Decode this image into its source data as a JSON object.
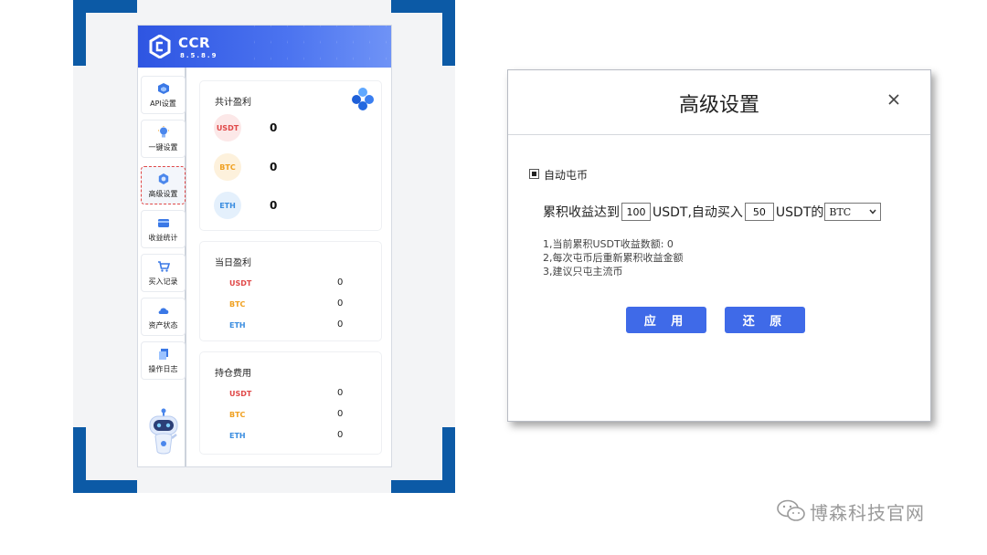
{
  "app": {
    "name": "CCR",
    "version": "8.5.8.9"
  },
  "sidebar": {
    "items": [
      {
        "label": "API设置",
        "icon": "cube-icon"
      },
      {
        "label": "一键设置",
        "icon": "bulb-icon"
      },
      {
        "label": "高级设置",
        "icon": "gear-icon"
      },
      {
        "label": "收益统计",
        "icon": "wallet-icon"
      },
      {
        "label": "买入记录",
        "icon": "cart-icon"
      },
      {
        "label": "资产状态",
        "icon": "cloud-icon"
      },
      {
        "label": "操作日志",
        "icon": "docs-icon"
      }
    ],
    "active_index": 2
  },
  "cards": {
    "total": {
      "title": "共计盈利",
      "rows": [
        {
          "coin": "USDT",
          "value": "0"
        },
        {
          "coin": "BTC",
          "value": "0"
        },
        {
          "coin": "ETH",
          "value": "0"
        }
      ]
    },
    "daily": {
      "title": "当日盈利",
      "rows": [
        {
          "coin": "USDT",
          "value": "0"
        },
        {
          "coin": "BTC",
          "value": "0"
        },
        {
          "coin": "ETH",
          "value": "0"
        }
      ]
    },
    "holding": {
      "title": "持仓费用",
      "rows": [
        {
          "coin": "USDT",
          "value": "0"
        },
        {
          "coin": "BTC",
          "value": "0"
        },
        {
          "coin": "ETH",
          "value": "0"
        }
      ]
    }
  },
  "dialog": {
    "title": "高级设置",
    "close_symbol": "×",
    "checkbox_label": "自动屯币",
    "checkbox_checked": true,
    "rule": {
      "prefix": "累积收益达到",
      "threshold": "100",
      "mid": "USDT,自动买入",
      "amount": "50",
      "suffix": "USDT的",
      "selected_coin": "BTC"
    },
    "notes": [
      "1,当前累积USDT收益数额: 0",
      "2,每次屯币后重新累积收益金额",
      "3,建议只屯主流币"
    ],
    "apply_label": "应 用",
    "reset_label": "还 原"
  },
  "watermark": {
    "text": "博森科技官网"
  },
  "colors": {
    "brand_blue": "#3f6ae8",
    "frame_blue": "#0c5aa6",
    "usdt": "#e04848",
    "btc": "#f0a020",
    "eth": "#3a8de0"
  }
}
